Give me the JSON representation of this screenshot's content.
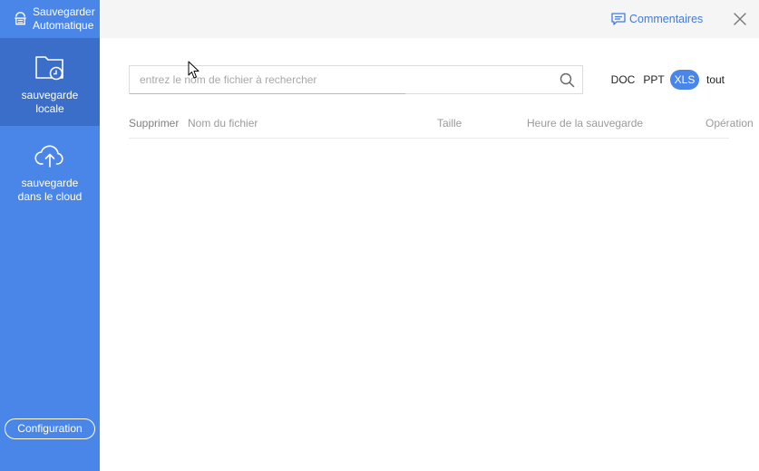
{
  "app": {
    "title_line1": "Sauvegarder",
    "title_line2": "Automatique",
    "logo_icon": "cloud-backup-logo-icon"
  },
  "sidebar": {
    "items": [
      {
        "label_line1": "sauvegarde",
        "label_line2": "locale",
        "icon": "folder-clock-icon",
        "active": true
      },
      {
        "label_line1": "sauvegarde",
        "label_line2": "dans le cloud",
        "icon": "cloud-upload-icon",
        "active": false
      }
    ],
    "config_label": "Configuration"
  },
  "topbar": {
    "feedback_label": "Commentaires",
    "feedback_icon": "comment-icon",
    "close_icon": "close-icon"
  },
  "search": {
    "placeholder": "entrez le nom de fichier à rechercher",
    "value": "",
    "icon": "search-icon"
  },
  "filters": {
    "doc": "DOC",
    "ppt": "PPT",
    "xls": "XLS",
    "all": "tout",
    "selected": "XLS"
  },
  "table": {
    "columns": {
      "delete": "Supprimer",
      "name": "Nom du fichier",
      "size": "Taille",
      "time": "Heure de la sauvegarde",
      "operation": "Opération"
    },
    "rows": []
  },
  "colors": {
    "sidebar": "#4a86e8",
    "sidebar_active": "#3b6ec8",
    "accent": "#3f7be0",
    "topbar": "#f5f5f5"
  }
}
